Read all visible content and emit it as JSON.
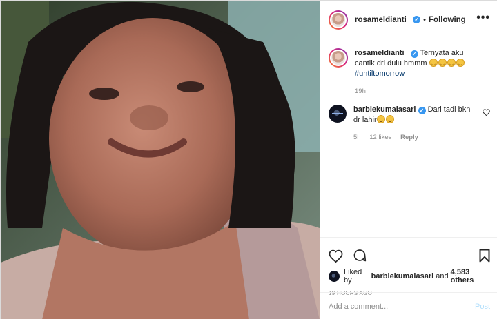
{
  "post": {
    "author": {
      "username": "rosameldianti_",
      "verified": true,
      "follow_status": "Following"
    },
    "more_options_label": "•••",
    "caption": {
      "username": "rosameldianti_",
      "text": "Ternyata aku cantik dri dulu hmmm",
      "emoji_count": 4,
      "emoji": "grinning-face-with-sweat",
      "hashtag": "#untiltomorrow",
      "time": "19h"
    },
    "comments": [
      {
        "username": "barbiekumalasari",
        "verified": true,
        "text": "Dari tadi bkn dr lahir",
        "emoji_count": 2,
        "emoji": "grinning-face",
        "time": "5h",
        "likes": "12 likes",
        "reply_label": "Reply"
      }
    ],
    "likes": {
      "prefix": "Liked by",
      "liker": "barbiekumalasari",
      "conjunction": "and",
      "others": "4,583 others"
    },
    "timestamp": "19 HOURS AGO",
    "add_comment": {
      "placeholder": "Add a comment...",
      "post_label": "Post"
    }
  },
  "colors": {
    "verified_badge": "#3897f0",
    "hashtag": "#003569",
    "post_button_disabled": "#b2dffc",
    "muted_text": "#8e8e8e",
    "border": "#efefef"
  },
  "icons": [
    "verified-icon",
    "more-options-icon",
    "heart-icon",
    "comment-icon",
    "bookmark-icon",
    "like-comment-heart-icon"
  ]
}
